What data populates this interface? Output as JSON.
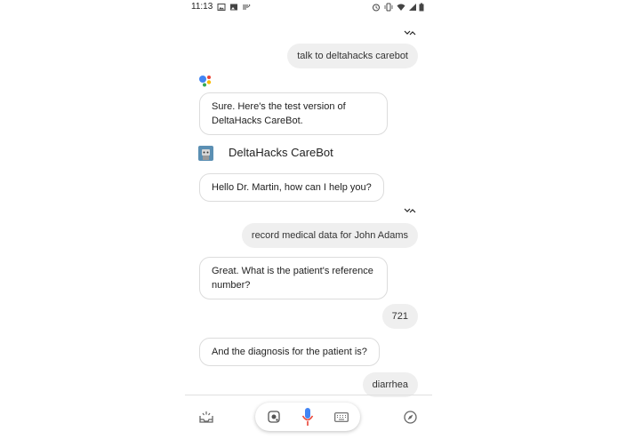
{
  "status": {
    "time": "11:13"
  },
  "conversation": {
    "user_msg_1": "talk to deltahacks carebot",
    "bot_msg_1": "Sure. Here's the test version of DeltaHacks CareBot.",
    "bot_name": "DeltaHacks CareBot",
    "bot_msg_2": "Hello Dr. Martin, how can I help you?",
    "user_msg_2": "record medical data for John Adams",
    "bot_msg_3": "Great. What is the patient's reference number?",
    "user_msg_3": "721",
    "bot_msg_4": "And the diagnosis for the patient is?",
    "user_msg_4": "diarrhea"
  },
  "icons": {
    "status": [
      "image-icon",
      "photo-icon",
      "notes-icon",
      "alarm-icon",
      "vibrate-icon",
      "wifi-icon",
      "signal-icon",
      "battery-icon"
    ],
    "bottom": [
      "updates-tray-icon",
      "lens-icon",
      "mic-icon",
      "keyboard-icon",
      "explore-compass-icon"
    ]
  },
  "colors": {
    "mic_blue": "#4285F4",
    "mic_red": "#EA4335",
    "assistant_green": "#34A853",
    "assistant_yellow": "#FBBC05"
  }
}
